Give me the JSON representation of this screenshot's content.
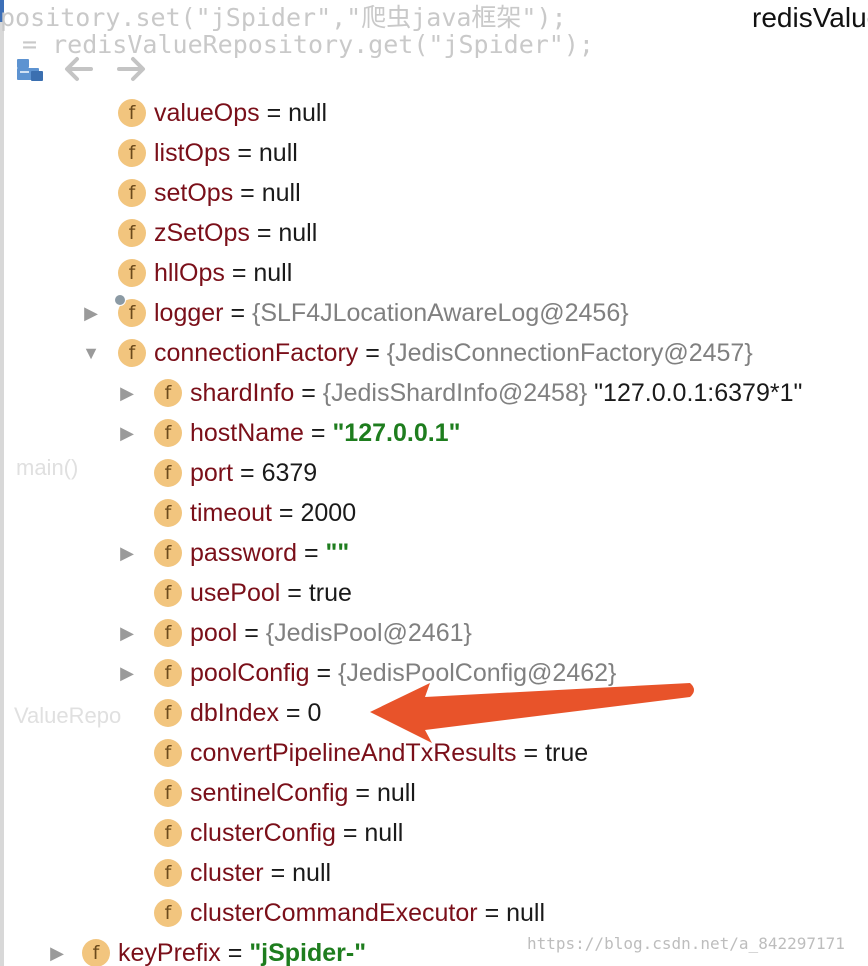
{
  "window": {
    "title": "redisValue"
  },
  "background_ghost": {
    "code_line_1": "pository.set(\"jSpider\",\"爬虫java框架\");",
    "code_line_2": "= redisValueRepository.get(\"jSpider\");",
    "frame_main": "main()",
    "frame_repo": "ValueRepo"
  },
  "toolbar": {
    "icons": [
      "frames-icon",
      "back-arrow-icon",
      "forward-arrow-icon"
    ]
  },
  "tree": [
    {
      "level": 1,
      "arrow": "none",
      "name": "valueOps",
      "eq": " = ",
      "value": "null",
      "type": "plain"
    },
    {
      "level": 1,
      "arrow": "none",
      "name": "listOps",
      "eq": " = ",
      "value": "null",
      "type": "plain"
    },
    {
      "level": 1,
      "arrow": "none",
      "name": "setOps",
      "eq": " = ",
      "value": "null",
      "type": "plain"
    },
    {
      "level": 1,
      "arrow": "none",
      "name": "zSetOps",
      "eq": " = ",
      "value": "null",
      "type": "plain"
    },
    {
      "level": 1,
      "arrow": "none",
      "name": "hllOps",
      "eq": " = ",
      "value": "null",
      "type": "plain"
    },
    {
      "level": 1,
      "arrow": "collapsed",
      "name": "logger",
      "eq": " = ",
      "value": "{SLF4JLocationAwareLog@2456}",
      "type": "ref",
      "lock": true
    },
    {
      "level": 1,
      "arrow": "expanded",
      "name": "connectionFactory",
      "eq": " = ",
      "value": "{JedisConnectionFactory@2457}",
      "type": "ref"
    },
    {
      "level": 2,
      "arrow": "collapsed",
      "name": "shardInfo",
      "eq": " = ",
      "value": "{JedisShardInfo@2458}",
      "type": "ref",
      "extra": " \"127.0.0.1:6379*1\""
    },
    {
      "level": 2,
      "arrow": "collapsed",
      "name": "hostName",
      "eq": " = ",
      "value": "\"127.0.0.1\"",
      "type": "str"
    },
    {
      "level": 2,
      "arrow": "none",
      "name": "port",
      "eq": " = ",
      "value": "6379",
      "type": "plain"
    },
    {
      "level": 2,
      "arrow": "none",
      "name": "timeout",
      "eq": " = ",
      "value": "2000",
      "type": "plain"
    },
    {
      "level": 2,
      "arrow": "collapsed",
      "name": "password",
      "eq": " = ",
      "value": "\"\"",
      "type": "str"
    },
    {
      "level": 2,
      "arrow": "none",
      "name": "usePool",
      "eq": " = ",
      "value": "true",
      "type": "plain"
    },
    {
      "level": 2,
      "arrow": "collapsed",
      "name": "pool",
      "eq": " = ",
      "value": "{JedisPool@2461}",
      "type": "ref"
    },
    {
      "level": 2,
      "arrow": "collapsed",
      "name": "poolConfig",
      "eq": " = ",
      "value": "{JedisPoolConfig@2462}",
      "type": "ref"
    },
    {
      "level": 2,
      "arrow": "none",
      "name": "dbIndex",
      "eq": " = ",
      "value": "0",
      "type": "plain"
    },
    {
      "level": 2,
      "arrow": "none",
      "name": "convertPipelineAndTxResults",
      "eq": " = ",
      "value": "true",
      "type": "plain"
    },
    {
      "level": 2,
      "arrow": "none",
      "name": "sentinelConfig",
      "eq": " = ",
      "value": "null",
      "type": "plain"
    },
    {
      "level": 2,
      "arrow": "none",
      "name": "clusterConfig",
      "eq": " = ",
      "value": "null",
      "type": "plain"
    },
    {
      "level": 2,
      "arrow": "none",
      "name": "cluster",
      "eq": " = ",
      "value": "null",
      "type": "plain"
    },
    {
      "level": 2,
      "arrow": "none",
      "name": "clusterCommandExecutor",
      "eq": " = ",
      "value": "null",
      "type": "plain"
    },
    {
      "level": 0,
      "arrow": "collapsed",
      "name": "keyPrefix",
      "eq": " = ",
      "value": "\"jSpider-\"",
      "type": "str"
    }
  ],
  "icon_letter": "f",
  "annotation": {
    "color": "#e8532a",
    "points_to": "dbIndex"
  },
  "watermark": "https://blog.csdn.net/a_842297171",
  "colors": {
    "field_name": "#7a0f19",
    "string_value": "#1e7d1e",
    "reference_value": "#808080",
    "field_icon": "#f2c57e"
  }
}
